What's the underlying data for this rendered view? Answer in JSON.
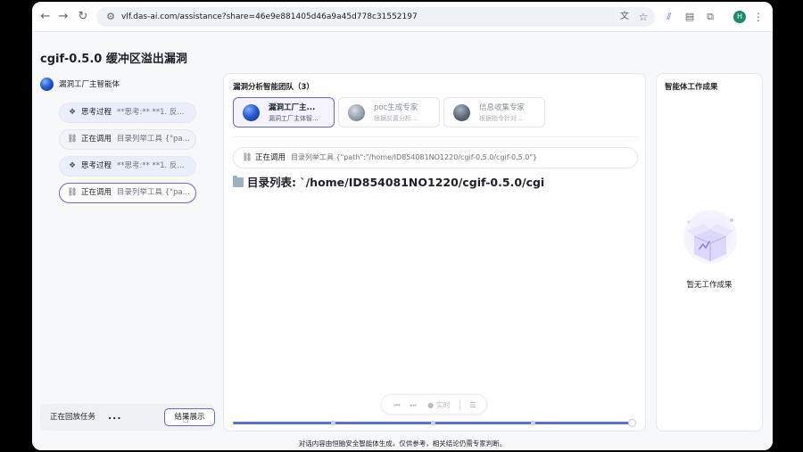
{
  "browser": {
    "url": "vlf.das-ai.com/assistance?share=46e9e881405d46a9a45d778c31552197",
    "nav_back": "←",
    "nav_forward": "→",
    "nav_reload": "↻",
    "profile_initial": "H"
  },
  "page": {
    "title": "cgif-0.5.0 缓冲区溢出漏洞"
  },
  "sidebar": {
    "agent_name": "漏洞工厂主智能体",
    "steps": [
      {
        "label": "思考过程",
        "detail": "**思考:** **1. 反..."
      },
      {
        "label": "正在调用",
        "detail": "目录列举工具 {\"pa..."
      },
      {
        "label": "思考过程",
        "detail": "**思考:** **1. 反..."
      },
      {
        "label": "正在调用",
        "detail": "目录列举工具 {\"pa..."
      }
    ],
    "playback_label": "正在回放任务",
    "playback_dots": "...",
    "result_button": "结果展示"
  },
  "team": {
    "title": "漏洞分析智能团队（3）",
    "agents": [
      {
        "name": "漏洞工厂主...",
        "sub": "漏洞工厂主体智..."
      },
      {
        "name": "poc生成专家",
        "sub": "根据前置分析..."
      },
      {
        "name": "信息收集专家",
        "sub": "根据指令针对..."
      }
    ],
    "tool_call_label": "正在调用",
    "tool_call_detail": "目录列举工具 {\"path\":\"/home/ID854081NO1220/cgif-0.5.0/cgif-0.5.0\"}",
    "dir_heading": "目录列表: `/home/ID854081NO1220/cgif-0.5.0/cgi",
    "player": {
      "prev": "⏮",
      "next": "⏭",
      "realtime": "● 实时"
    },
    "progress": 0.99
  },
  "results": {
    "title": "智能体工作成果",
    "empty_label": "暂无工作成果"
  },
  "footer": {
    "note": "对话内容由恒脑安全智能体生成，仅供参考，相关结论仍需专家判断。"
  },
  "colors": {
    "accent": "#6b63d9",
    "progress": "#5b6dd6"
  }
}
